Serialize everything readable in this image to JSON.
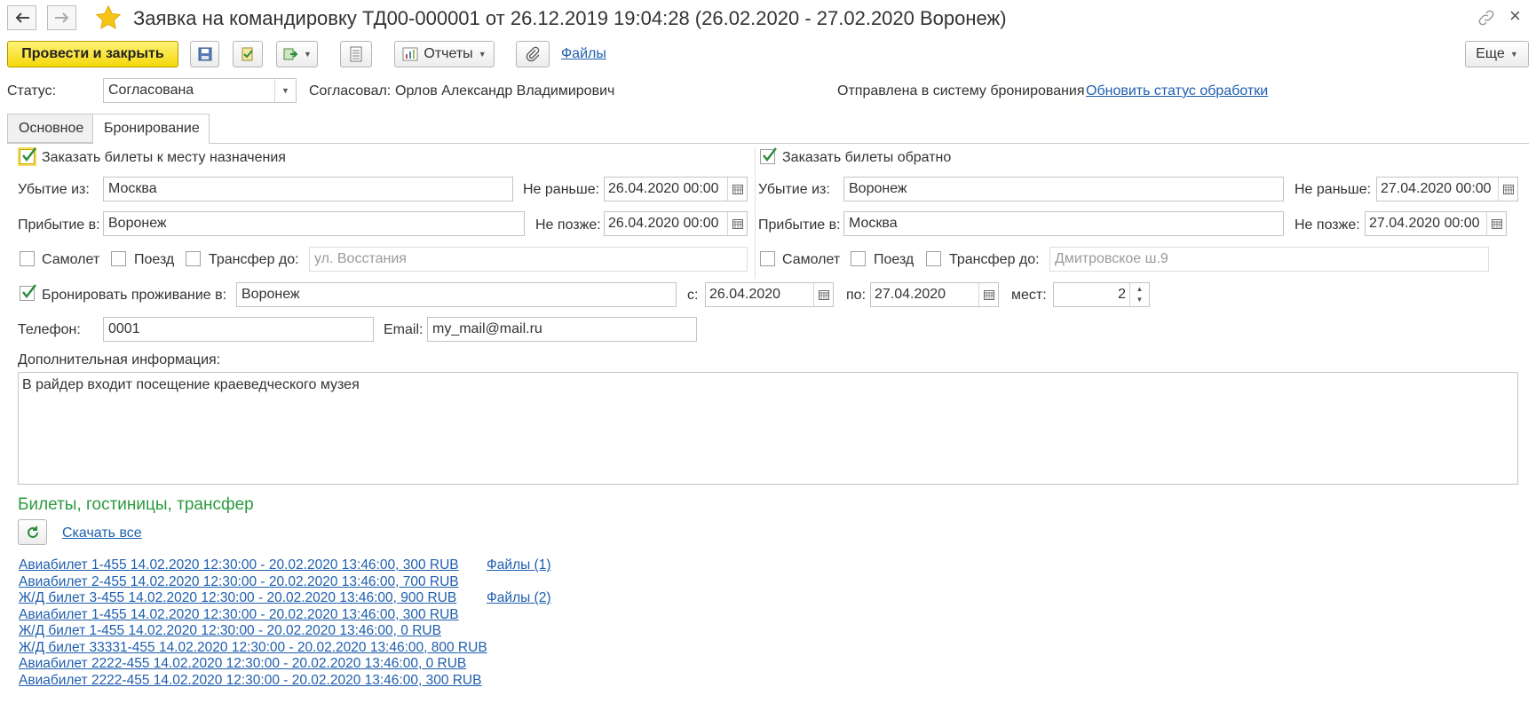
{
  "window": {
    "title": "Заявка на командировку ТД00-000001 от 26.12.2019 19:04:28 (26.02.2020 - 27.02.2020 Воронеж)",
    "nav_back": "←",
    "nav_forward": "→",
    "close": "×"
  },
  "toolbar": {
    "post_close": "Провести и закрыть",
    "reports": "Отчеты",
    "files": "Файлы",
    "more": "Еще"
  },
  "status": {
    "label": "Статус:",
    "value": "Согласована",
    "approved_label": "Согласовал:",
    "approved_by": "Орлов Александр Владимирович",
    "sent_text": "Отправлена в систему бронирования",
    "refresh_link": "Обновить статус обработки"
  },
  "tabs": [
    {
      "label": "Основное",
      "active": false
    },
    {
      "label": "Бронирование",
      "active": true
    }
  ],
  "outbound": {
    "order_label": "Заказать билеты к месту назначения",
    "order_checked": true,
    "depart_label": "Убытие из:",
    "depart_value": "Москва",
    "not_earlier_label": "Не раньше:",
    "not_earlier_value": "26.04.2020 00:00",
    "arrive_label": "Прибытие в:",
    "arrive_value": "Воронеж",
    "not_later_label": "Не позже:",
    "not_later_value": "26.04.2020 00:00",
    "plane_label": "Самолет",
    "train_label": "Поезд",
    "transfer_label": "Трансфер до:",
    "transfer_value": "ул. Восстания"
  },
  "return": {
    "order_label": "Заказать билеты обратно",
    "order_checked": true,
    "depart_label": "Убытие из:",
    "depart_value": "Воронеж",
    "not_earlier_label": "Не раньше:",
    "not_earlier_value": "27.04.2020 00:00",
    "arrive_label": "Прибытие в:",
    "arrive_value": "Москва",
    "not_later_label": "Не позже:",
    "not_later_value": "27.04.2020 00:00",
    "plane_label": "Самолет",
    "train_label": "Поезд",
    "transfer_label": "Трансфер до:",
    "transfer_value": "Дмитровское ш.9"
  },
  "lodging": {
    "label": "Бронировать проживание в:",
    "checked": true,
    "city": "Воронеж",
    "from_label": "с:",
    "from_value": "26.04.2020",
    "to_label": "по:",
    "to_value": "27.04.2020",
    "places_label": "мест:",
    "places_value": "2"
  },
  "contacts": {
    "phone_label": "Телефон:",
    "phone_value": "0001",
    "email_label": "Email:",
    "email_value": "my_mail@mail.ru"
  },
  "additional": {
    "label": "Дополнительная информация:",
    "value": "В райдер входит посещение краеведческого музея"
  },
  "tickets": {
    "title": "Билеты, гостиницы, трансфер",
    "download_all": "Скачать все",
    "items": [
      {
        "text": "Авиабилет 1-455 14.02.2020 12:30:00 - 20.02.2020 13:46:00, 300 RUB",
        "files": "Файлы (1)"
      },
      {
        "text": "Авиабилет 2-455 14.02.2020 12:30:00 - 20.02.2020 13:46:00, 700 RUB",
        "files": ""
      },
      {
        "text": "Ж/Д билет 3-455 14.02.2020 12:30:00 - 20.02.2020 13:46:00, 900 RUB",
        "files": "Файлы (2)"
      },
      {
        "text": "Авиабилет 1-455 14.02.2020 12:30:00 - 20.02.2020 13:46:00, 300 RUB",
        "files": ""
      },
      {
        "text": "Ж/Д билет 1-455 14.02.2020 12:30:00 - 20.02.2020 13:46:00, 0 RUB",
        "files": ""
      },
      {
        "text": "Ж/Д билет 33331-455 14.02.2020 12:30:00 - 20.02.2020 13:46:00, 800 RUB",
        "files": ""
      },
      {
        "text": "Авиабилет 2222-455 14.02.2020 12:30:00 - 20.02.2020 13:46:00, 0 RUB",
        "files": ""
      },
      {
        "text": "Авиабилет 2222-455 14.02.2020 12:30:00 - 20.02.2020 13:46:00, 300 RUB",
        "files": ""
      }
    ]
  },
  "colors": {
    "primary_button": "#f5d90a",
    "link": "#1f5fae",
    "section_title": "#2b9a3f",
    "check_mark": "#2e8b3a"
  }
}
